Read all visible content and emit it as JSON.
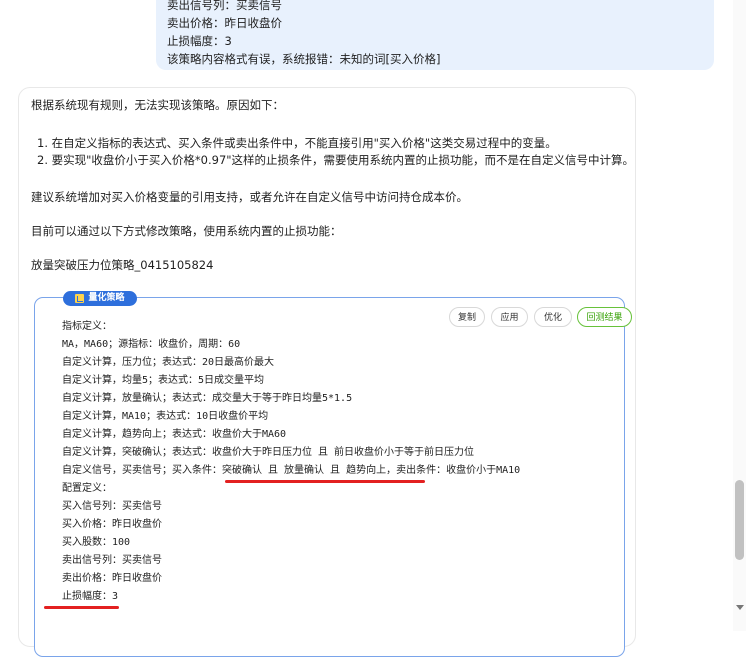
{
  "user_message": {
    "lines": [
      "卖出信号列：买卖信号",
      "卖出价格：昨日收盘价",
      "止损幅度：3",
      "该策略内容格式有误，系统报错：未知的词[买入价格]"
    ]
  },
  "ai_message": {
    "intro": "根据系统现有规则，无法实现该策略。原因如下：",
    "reasons": [
      "1. 在自定义指标的表达式、买入条件或卖出条件中，不能直接引用\"买入价格\"这类交易过程中的变量。",
      "2. 要实现\"收盘价小于买入价格*0.97\"这样的止损条件，需要使用系统内置的止损功能，而不是在自定义信号中计算。"
    ],
    "suggestion": "建议系统增加对买入价格变量的引用支持，或者允许在自定义信号中访问持仓成本价。",
    "modify_hint": "目前可以通过以下方式修改策略，使用系统内置的止损功能：",
    "strategy_name": "放量突破压力位策略_0415105824"
  },
  "strategy_box": {
    "tag_label": "量化策略",
    "buttons": {
      "copy": "复制",
      "apply": "应用",
      "optimize": "优化",
      "backtest": "回测结果"
    },
    "code_lines": [
      "指标定义：",
      "MA，MA60；源指标：收盘价，周期：60",
      "自定义计算，压力位；表达式：20日最高价最大",
      "自定义计算，均量5；表达式：5日成交量平均",
      "自定义计算，放量确认；表达式：成交量大于等于昨日均量5*1.5",
      "自定义计算，MA10；表达式：10日收盘价平均",
      "自定义计算，趋势向上；表达式：收盘价大于MA60",
      "自定义计算，突破确认；表达式：收盘价大于昨日压力位 且 前日收盘价小于等于前日压力位",
      "自定义信号，买卖信号；买入条件：突破确认 且 放量确认 且 趋势向上，卖出条件：收盘价小于MA10",
      "配置定义：",
      "买入信号列：买卖信号",
      "买入价格：昨日收盘价",
      "买入股数：100",
      "卖出信号列：买卖信号",
      "卖出价格：昨日收盘价",
      "止损幅度：3"
    ]
  },
  "colors": {
    "user_bubble": "#e8f1fd",
    "accent_blue": "#2e6fdc",
    "annotation_red": "#e32020",
    "test_green": "#67c23a"
  }
}
